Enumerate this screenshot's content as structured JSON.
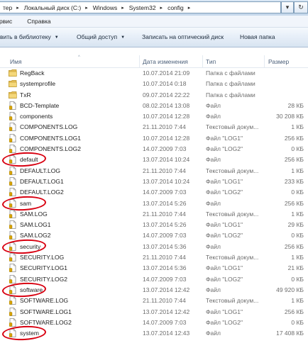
{
  "address_bar": {
    "crumbs": [
      "тер",
      "Локальный диск (C:)",
      "Windows",
      "System32",
      "config"
    ]
  },
  "menu": [
    "рвис",
    "Справка"
  ],
  "toolbar": {
    "library": "вить в библиотеку",
    "share": "Общий доступ",
    "burn": "Записать на оптический диск",
    "new_folder": "Новая папка"
  },
  "columns": {
    "name": "Имя",
    "date": "Дата изменения",
    "type": "Тип",
    "size": "Размер"
  },
  "files": [
    {
      "name": "RegBack",
      "date": "10.07.2014 21:09",
      "type": "Папка с файлами",
      "size": "",
      "icon": "folder-icon"
    },
    {
      "name": "systemprofile",
      "date": "10.07.2014 0:18",
      "type": "Папка с файлами",
      "size": "",
      "icon": "folder-icon"
    },
    {
      "name": "TxR",
      "date": "09.07.2014 22:22",
      "type": "Папка с файлами",
      "size": "",
      "icon": "folder-icon"
    },
    {
      "name": "BCD-Template",
      "date": "08.02.2014 13:08",
      "type": "Файл",
      "size": "28 КБ",
      "icon": "file-icon"
    },
    {
      "name": "components",
      "date": "10.07.2014 12:28",
      "type": "Файл",
      "size": "30 208 КБ",
      "icon": "file-icon"
    },
    {
      "name": "COMPONENTS.LOG",
      "date": "21.11.2010 7:44",
      "type": "Текстовый докум...",
      "size": "1 КБ",
      "icon": "file-icon"
    },
    {
      "name": "COMPONENTS.LOG1",
      "date": "10.07.2014 12:28",
      "type": "Файл \"LOG1\"",
      "size": "256 КБ",
      "icon": "file-icon"
    },
    {
      "name": "COMPONENTS.LOG2",
      "date": "14.07.2009 7:03",
      "type": "Файл \"LOG2\"",
      "size": "0 КБ",
      "icon": "file-icon"
    },
    {
      "name": "default",
      "date": "13.07.2014 10:24",
      "type": "Файл",
      "size": "256 КБ",
      "icon": "file-icon"
    },
    {
      "name": "DEFAULT.LOG",
      "date": "21.11.2010 7:44",
      "type": "Текстовый докум...",
      "size": "1 КБ",
      "icon": "file-icon"
    },
    {
      "name": "DEFAULT.LOG1",
      "date": "13.07.2014 10:24",
      "type": "Файл \"LOG1\"",
      "size": "233 КБ",
      "icon": "file-icon"
    },
    {
      "name": "DEFAULT.LOG2",
      "date": "14.07.2009 7:03",
      "type": "Файл \"LOG2\"",
      "size": "0 КБ",
      "icon": "file-icon"
    },
    {
      "name": "sam",
      "date": "13.07.2014 5:26",
      "type": "Файл",
      "size": "256 КБ",
      "icon": "file-icon"
    },
    {
      "name": "SAM.LOG",
      "date": "21.11.2010 7:44",
      "type": "Текстовый докум...",
      "size": "1 КБ",
      "icon": "file-icon"
    },
    {
      "name": "SAM.LOG1",
      "date": "13.07.2014 5:26",
      "type": "Файл \"LOG1\"",
      "size": "29 КБ",
      "icon": "file-icon"
    },
    {
      "name": "SAM.LOG2",
      "date": "14.07.2009 7:03",
      "type": "Файл \"LOG2\"",
      "size": "0 КБ",
      "icon": "file-icon"
    },
    {
      "name": "security",
      "date": "13.07.2014 5:36",
      "type": "Файл",
      "size": "256 КБ",
      "icon": "file-icon"
    },
    {
      "name": "SECURITY.LOG",
      "date": "21.11.2010 7:44",
      "type": "Текстовый докум...",
      "size": "1 КБ",
      "icon": "file-icon"
    },
    {
      "name": "SECURITY.LOG1",
      "date": "13.07.2014 5:36",
      "type": "Файл \"LOG1\"",
      "size": "21 КБ",
      "icon": "file-icon"
    },
    {
      "name": "SECURITY.LOG2",
      "date": "14.07.2009 7:03",
      "type": "Файл \"LOG2\"",
      "size": "0 КБ",
      "icon": "file-icon"
    },
    {
      "name": "software",
      "date": "13.07.2014 12:42",
      "type": "Файл",
      "size": "49 920 КБ",
      "icon": "file-icon"
    },
    {
      "name": "SOFTWARE.LOG",
      "date": "21.11.2010 7:44",
      "type": "Текстовый докум...",
      "size": "1 КБ",
      "icon": "file-icon"
    },
    {
      "name": "SOFTWARE.LOG1",
      "date": "13.07.2014 12:42",
      "type": "Файл \"LOG1\"",
      "size": "256 КБ",
      "icon": "file-icon"
    },
    {
      "name": "SOFTWARE.LOG2",
      "date": "14.07.2009 7:03",
      "type": "Файл \"LOG2\"",
      "size": "0 КБ",
      "icon": "file-icon"
    },
    {
      "name": "system",
      "date": "13.07.2014 12:43",
      "type": "Файл",
      "size": "17 408 КБ",
      "icon": "file-icon"
    }
  ],
  "highlighted_files": [
    "default",
    "sam",
    "security",
    "software",
    "system"
  ],
  "colors": {
    "highlight_ring": "#d80010",
    "folder": "#e8c15a",
    "lock_badge": "#d9a400"
  }
}
